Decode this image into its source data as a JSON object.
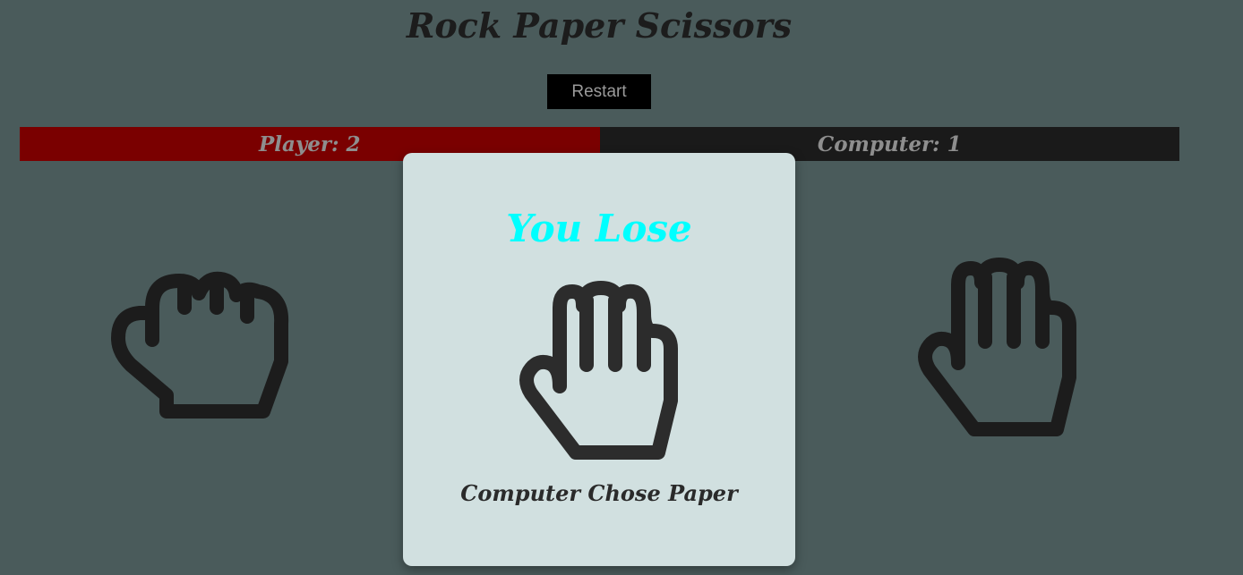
{
  "app": {
    "title": "Rock Paper Scissors"
  },
  "controls": {
    "restart_label": "Restart"
  },
  "scoreboard": {
    "player_label": "Player: 2",
    "computer_label": "Computer: 1"
  },
  "choices": [
    {
      "name": "rock",
      "icon": "rock-fist-icon"
    },
    {
      "name": "paper",
      "icon": "paper-hand-icon"
    }
  ],
  "modal": {
    "result_text": "You Lose",
    "computer_choice_text": "Computer Chose Paper",
    "icon": "paper-hand-icon"
  },
  "colors": {
    "background": "#4a5b5b",
    "player_bar": "#7a0000",
    "computer_bar": "#1a1a1a",
    "result_text": "#00ffff",
    "modal_bg": "#d1e0e0"
  }
}
